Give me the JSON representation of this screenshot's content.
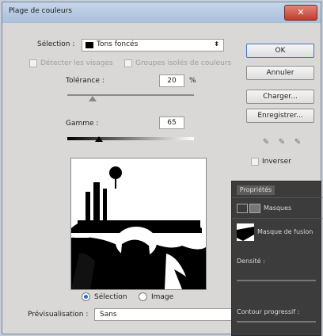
{
  "window": {
    "title": "Plage de couleurs",
    "close_glyph": "✕"
  },
  "selection": {
    "label": "Sélection :",
    "value": "Tons foncés",
    "swatch_color": "#000000"
  },
  "options": {
    "detect_faces": "Détecter les visages",
    "localized_clusters": "Groupes isolés de couleurs"
  },
  "tolerance": {
    "label": "Tolérance :",
    "value": "20",
    "unit": "%",
    "slider_fraction": 0.2
  },
  "gamma": {
    "label": "Gamme :",
    "value": "65",
    "slider_fraction": 0.25
  },
  "preview": {
    "radio_selection": "Sélection",
    "radio_image": "Image",
    "selected": "Sélection"
  },
  "buttons": {
    "ok": "OK",
    "cancel": "Annuler",
    "load": "Charger...",
    "save": "Enregistrer..."
  },
  "invert": {
    "label": "Inverser"
  },
  "previsualisation": {
    "label": "Prévisualisation :",
    "value": "Sans"
  },
  "properties_panel": {
    "tab": "Propriétés",
    "masks_label": "Masques",
    "fusion_mask_label": "Masque de fusion",
    "density_label": "Densité :",
    "feather_label": "Contour progressif :"
  }
}
